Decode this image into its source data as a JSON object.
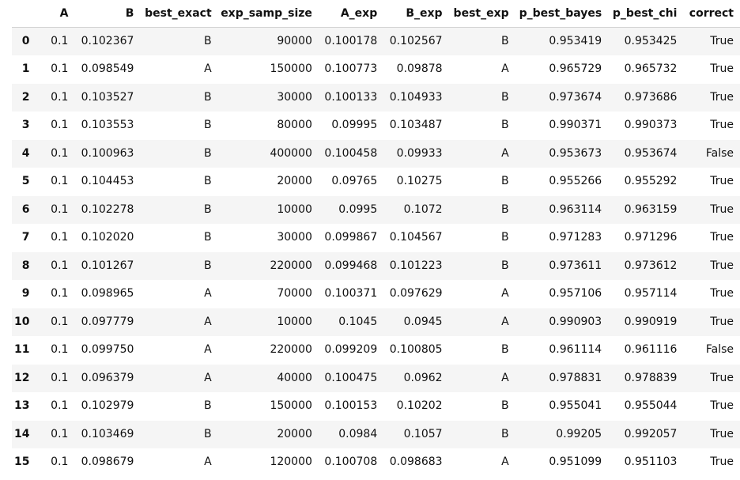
{
  "table": {
    "columns": [
      "A",
      "B",
      "best_exact",
      "exp_samp_size",
      "A_exp",
      "B_exp",
      "best_exp",
      "p_best_bayes",
      "p_best_chi",
      "correct"
    ],
    "rows": [
      {
        "index": "0",
        "cells": [
          "0.1",
          "0.102367",
          "B",
          "90000",
          "0.100178",
          "0.102567",
          "B",
          "0.953419",
          "0.953425",
          "True"
        ]
      },
      {
        "index": "1",
        "cells": [
          "0.1",
          "0.098549",
          "A",
          "150000",
          "0.100773",
          "0.09878",
          "A",
          "0.965729",
          "0.965732",
          "True"
        ]
      },
      {
        "index": "2",
        "cells": [
          "0.1",
          "0.103527",
          "B",
          "30000",
          "0.100133",
          "0.104933",
          "B",
          "0.973674",
          "0.973686",
          "True"
        ]
      },
      {
        "index": "3",
        "cells": [
          "0.1",
          "0.103553",
          "B",
          "80000",
          "0.09995",
          "0.103487",
          "B",
          "0.990371",
          "0.990373",
          "True"
        ]
      },
      {
        "index": "4",
        "cells": [
          "0.1",
          "0.100963",
          "B",
          "400000",
          "0.100458",
          "0.09933",
          "A",
          "0.953673",
          "0.953674",
          "False"
        ]
      },
      {
        "index": "5",
        "cells": [
          "0.1",
          "0.104453",
          "B",
          "20000",
          "0.09765",
          "0.10275",
          "B",
          "0.955266",
          "0.955292",
          "True"
        ]
      },
      {
        "index": "6",
        "cells": [
          "0.1",
          "0.102278",
          "B",
          "10000",
          "0.0995",
          "0.1072",
          "B",
          "0.963114",
          "0.963159",
          "True"
        ]
      },
      {
        "index": "7",
        "cells": [
          "0.1",
          "0.102020",
          "B",
          "30000",
          "0.099867",
          "0.104567",
          "B",
          "0.971283",
          "0.971296",
          "True"
        ]
      },
      {
        "index": "8",
        "cells": [
          "0.1",
          "0.101267",
          "B",
          "220000",
          "0.099468",
          "0.101223",
          "B",
          "0.973611",
          "0.973612",
          "True"
        ]
      },
      {
        "index": "9",
        "cells": [
          "0.1",
          "0.098965",
          "A",
          "70000",
          "0.100371",
          "0.097629",
          "A",
          "0.957106",
          "0.957114",
          "True"
        ]
      },
      {
        "index": "10",
        "cells": [
          "0.1",
          "0.097779",
          "A",
          "10000",
          "0.1045",
          "0.0945",
          "A",
          "0.990903",
          "0.990919",
          "True"
        ]
      },
      {
        "index": "11",
        "cells": [
          "0.1",
          "0.099750",
          "A",
          "220000",
          "0.099209",
          "0.100805",
          "B",
          "0.961114",
          "0.961116",
          "False"
        ]
      },
      {
        "index": "12",
        "cells": [
          "0.1",
          "0.096379",
          "A",
          "40000",
          "0.100475",
          "0.0962",
          "A",
          "0.978831",
          "0.978839",
          "True"
        ]
      },
      {
        "index": "13",
        "cells": [
          "0.1",
          "0.102979",
          "B",
          "150000",
          "0.100153",
          "0.10202",
          "B",
          "0.955041",
          "0.955044",
          "True"
        ]
      },
      {
        "index": "14",
        "cells": [
          "0.1",
          "0.103469",
          "B",
          "20000",
          "0.0984",
          "0.1057",
          "B",
          "0.99205",
          "0.992057",
          "True"
        ]
      },
      {
        "index": "15",
        "cells": [
          "0.1",
          "0.098679",
          "A",
          "120000",
          "0.100708",
          "0.098683",
          "A",
          "0.951099",
          "0.951103",
          "True"
        ]
      }
    ]
  },
  "colors": {
    "stripe": "#f5f5f5",
    "header_border": "#d0d0d0",
    "text": "#111111"
  }
}
